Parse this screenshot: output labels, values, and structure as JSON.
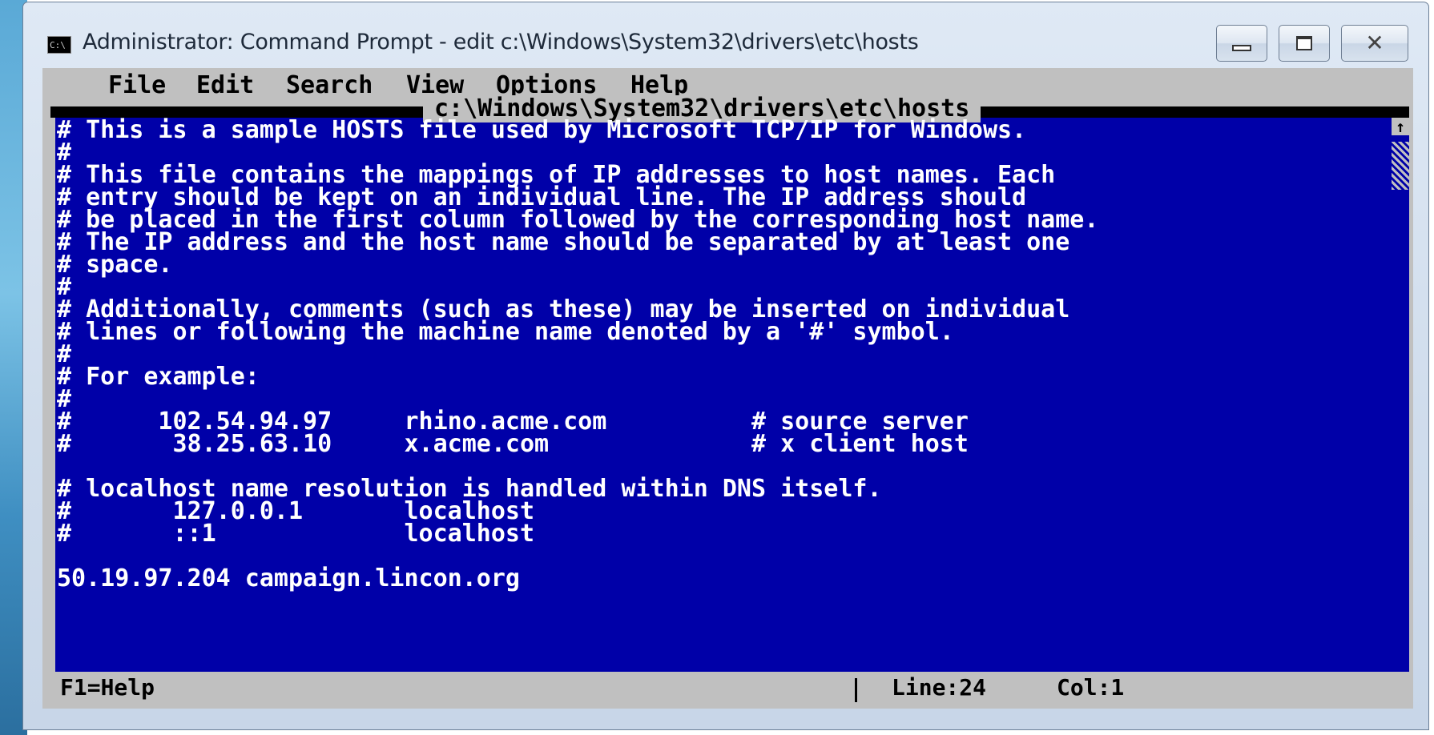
{
  "window": {
    "title": "Administrator: Command Prompt - edit  c:\\Windows\\System32\\drivers\\etc\\hosts",
    "icon_label": "C:\\",
    "icons": {
      "app": "console-icon",
      "minimize": "minimize-icon",
      "maximize": "maximize-icon",
      "close": "close-icon"
    },
    "close_glyph": "✕"
  },
  "menu": {
    "items": [
      {
        "label": "File"
      },
      {
        "label": "Edit"
      },
      {
        "label": "Search"
      },
      {
        "label": "View"
      },
      {
        "label": "Options"
      },
      {
        "label": "Help"
      }
    ]
  },
  "editor": {
    "file_path": "c:\\Windows\\System32\\drivers\\etc\\hosts",
    "lines": [
      "# This is a sample HOSTS file used by Microsoft TCP/IP for Windows.",
      "#",
      "# This file contains the mappings of IP addresses to host names. Each",
      "# entry should be kept on an individual line. The IP address should",
      "# be placed in the first column followed by the corresponding host name.",
      "# The IP address and the host name should be separated by at least one",
      "# space.",
      "#",
      "# Additionally, comments (such as these) may be inserted on individual",
      "# lines or following the machine name denoted by a '#' symbol.",
      "#",
      "# For example:",
      "#",
      "#      102.54.94.97     rhino.acme.com          # source server",
      "#       38.25.63.10     x.acme.com              # x client host",
      "",
      "# localhost name resolution is handled within DNS itself.",
      "#       127.0.0.1       localhost",
      "#       ::1             localhost",
      "",
      "50.19.97.204 campaign.lincon.org"
    ],
    "scroll_up": "↑",
    "scroll_down": "↓"
  },
  "status": {
    "help": "F1=Help",
    "line": "Line:24",
    "col": "Col:1"
  }
}
